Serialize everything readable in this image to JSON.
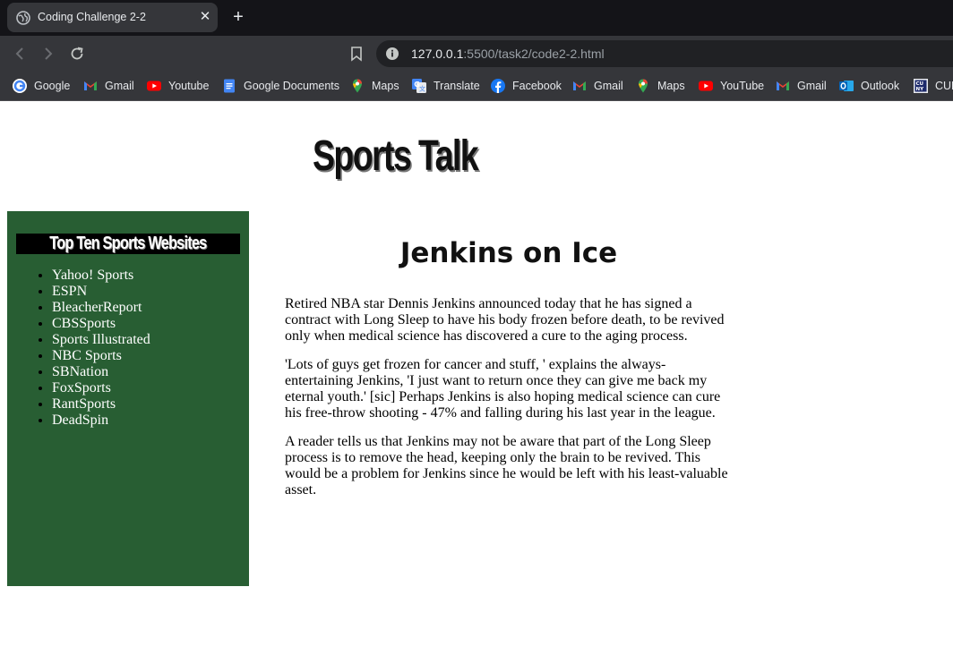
{
  "browser": {
    "tab_title": "Coding Challenge 2-2",
    "url_host": "127.0.0.1",
    "url_path": ":5500/task2/code2-2.html"
  },
  "bookmarks": [
    {
      "label": "Google",
      "icon": "google-icon"
    },
    {
      "label": "Gmail",
      "icon": "gmail-icon"
    },
    {
      "label": "Youtube",
      "icon": "youtube-icon"
    },
    {
      "label": "Google Documents",
      "icon": "docs-icon"
    },
    {
      "label": "Maps",
      "icon": "maps-icon"
    },
    {
      "label": "Translate",
      "icon": "translate-icon"
    },
    {
      "label": "Facebook",
      "icon": "facebook-icon"
    },
    {
      "label": "Gmail",
      "icon": "gmail-icon"
    },
    {
      "label": "Maps",
      "icon": "maps-icon"
    },
    {
      "label": "YouTube",
      "icon": "youtube-icon"
    },
    {
      "label": "Gmail",
      "icon": "gmail-icon"
    },
    {
      "label": "Outlook",
      "icon": "outlook-icon"
    },
    {
      "label": "CUNY",
      "icon": "cuny-icon"
    }
  ],
  "page": {
    "site_title": "Sports Talk",
    "sidebar_heading": "Top Ten Sports Websites",
    "sidebar_links": [
      "Yahoo! Sports",
      "ESPN",
      "BleacherReport",
      "CBSSports",
      "Sports Illustrated",
      "NBC Sports",
      "SBNation",
      "FoxSports",
      "RantSports",
      "DeadSpin"
    ],
    "article_title": "Jenkins on Ice",
    "paragraphs": [
      "Retired NBA star Dennis Jenkins announced today that he has signed a contract with Long Sleep to have his body frozen before death, to be revived only when medical science has discovered a cure to the aging process.",
      "'Lots of guys get frozen for cancer and stuff, ' explains the always-entertaining Jenkins, 'I just want to return once they can give me back my eternal youth.' [sic] Perhaps Jenkins is also hoping medical science can cure his free-throw shooting - 47% and falling during his last year in the league.",
      "A reader tells us that Jenkins may not be aware that part of the Long Sleep process is to remove the head, keeping only the brain to be revived. This would be a problem for Jenkins since he would be left with his least-valuable asset."
    ]
  },
  "colors": {
    "sidebar_bg": "#285e33",
    "chrome_dark": "#141418",
    "chrome_toolbar": "#35363a"
  }
}
